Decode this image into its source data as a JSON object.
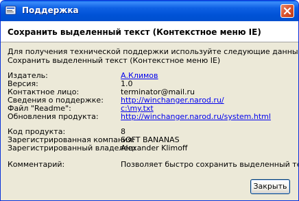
{
  "window": {
    "title": "Поддержка",
    "heading": "Сохранить выделенный текст (Контекстное меню IE)"
  },
  "intro": {
    "line1": "Для получения технической поддержки используйте следующие данные",
    "line2": "Сохранить выделенный текст (Контекстное меню IE)"
  },
  "info": [
    {
      "label": "Издатель:",
      "value": "А.Климов"
    },
    {
      "label": "Версия:",
      "value": "1.0"
    },
    {
      "label": "Контактное лицо:",
      "value": "terminator@mail.ru"
    },
    {
      "label": "Сведения о поддержке:",
      "value": "http://winchanger.narod.ru/"
    },
    {
      "label": "Файл \"Readme\":",
      "value": "c:\\my.txt"
    },
    {
      "label": "Обновления продукта:",
      "value": "http://winchanger.narod.ru/system.html"
    }
  ],
  "registration": [
    {
      "label": "Код продукта:",
      "value": "8"
    },
    {
      "label": "Зарегистрированная компания:",
      "value": "SOFT BANANAS"
    },
    {
      "label": "Зарегистрированный владелец:",
      "value": "Alexander Klimoff"
    }
  ],
  "comment": {
    "label": "Комментарий:",
    "value": "Позволяет быстро сохранить выделенный текст"
  },
  "buttons": {
    "close": "Закрыть"
  },
  "icons": {
    "app": "app-icon",
    "close": "close-icon"
  },
  "colors": {
    "titlebar": "#0054e3",
    "link": "#0000ee",
    "dialog_bg": "#ece9d8"
  }
}
